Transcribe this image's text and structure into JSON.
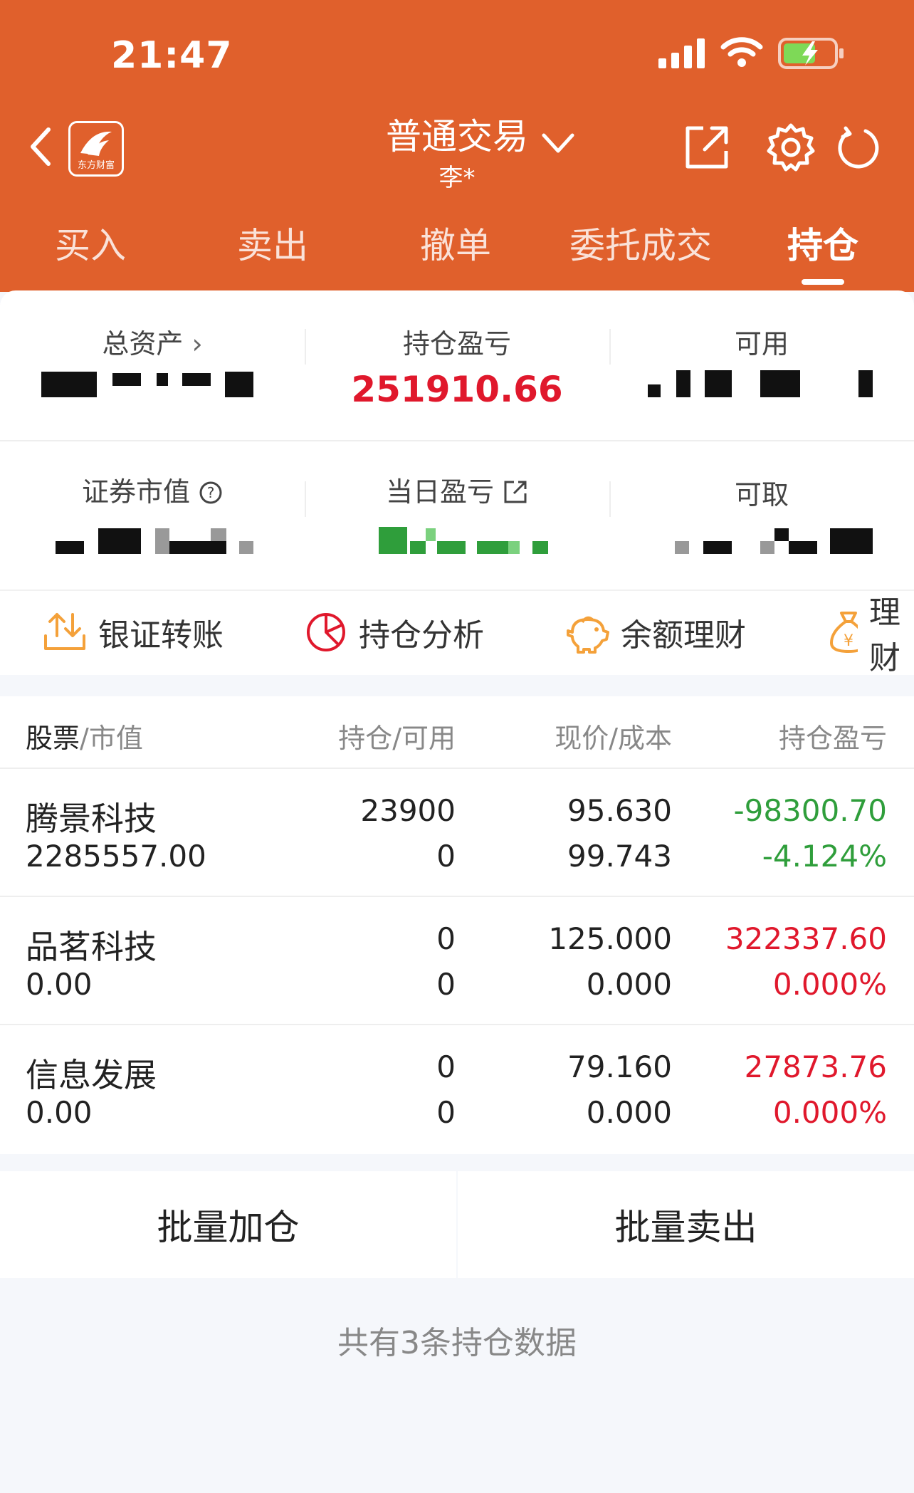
{
  "status_bar": {
    "time": "21:47"
  },
  "nav": {
    "logo_text": "东方财富",
    "title": "普通交易",
    "account_name": "李*"
  },
  "tabs": [
    {
      "label": "买入"
    },
    {
      "label": "卖出"
    },
    {
      "label": "撤单"
    },
    {
      "label": "委托成交"
    },
    {
      "label": "持仓",
      "active": true
    }
  ],
  "summary": {
    "total_assets_label": "总资产",
    "position_pnl_label": "持仓盈亏",
    "position_pnl_value": "251910.66",
    "available_label": "可用",
    "market_value_label": "证券市值",
    "daily_pnl_label": "当日盈亏",
    "withdrawable_label": "可取"
  },
  "quick_actions": [
    {
      "label": "银证转账",
      "icon": "transfer-icon"
    },
    {
      "label": "持仓分析",
      "icon": "pie-chart-icon"
    },
    {
      "label": "余额理财",
      "icon": "piggy-bank-icon"
    },
    {
      "label": "理财",
      "icon": "money-bag-icon"
    }
  ],
  "table": {
    "headers": {
      "stock": "股票",
      "stock_sub": "/市值",
      "holding": "持仓/可用",
      "price": "现价/成本",
      "pnl": "持仓盈亏"
    },
    "rows": [
      {
        "name": "腾景科技",
        "market_value": "2285557.00",
        "holding": "23900",
        "available": "0",
        "price": "95.630",
        "cost": "99.743",
        "pnl": "-98300.70",
        "pnl_pct": "-4.124%",
        "trend": "down"
      },
      {
        "name": "品茗科技",
        "market_value": "0.00",
        "holding": "0",
        "available": "0",
        "price": "125.000",
        "cost": "0.000",
        "pnl": "322337.60",
        "pnl_pct": "0.000%",
        "trend": "up"
      },
      {
        "name": "信息发展",
        "market_value": "0.00",
        "holding": "0",
        "available": "0",
        "price": "79.160",
        "cost": "0.000",
        "pnl": "27873.76",
        "pnl_pct": "0.000%",
        "trend": "up"
      }
    ]
  },
  "buttons": {
    "batch_add": "批量加仓",
    "batch_sell": "批量卖出"
  },
  "footer": {
    "summary": "共有3条持仓数据"
  },
  "colors": {
    "header_bg": "#e0602c",
    "profit": "#e0182c",
    "loss": "#2f9e3b",
    "icon_orange": "#f4a13a",
    "icon_red": "#e0182c"
  }
}
